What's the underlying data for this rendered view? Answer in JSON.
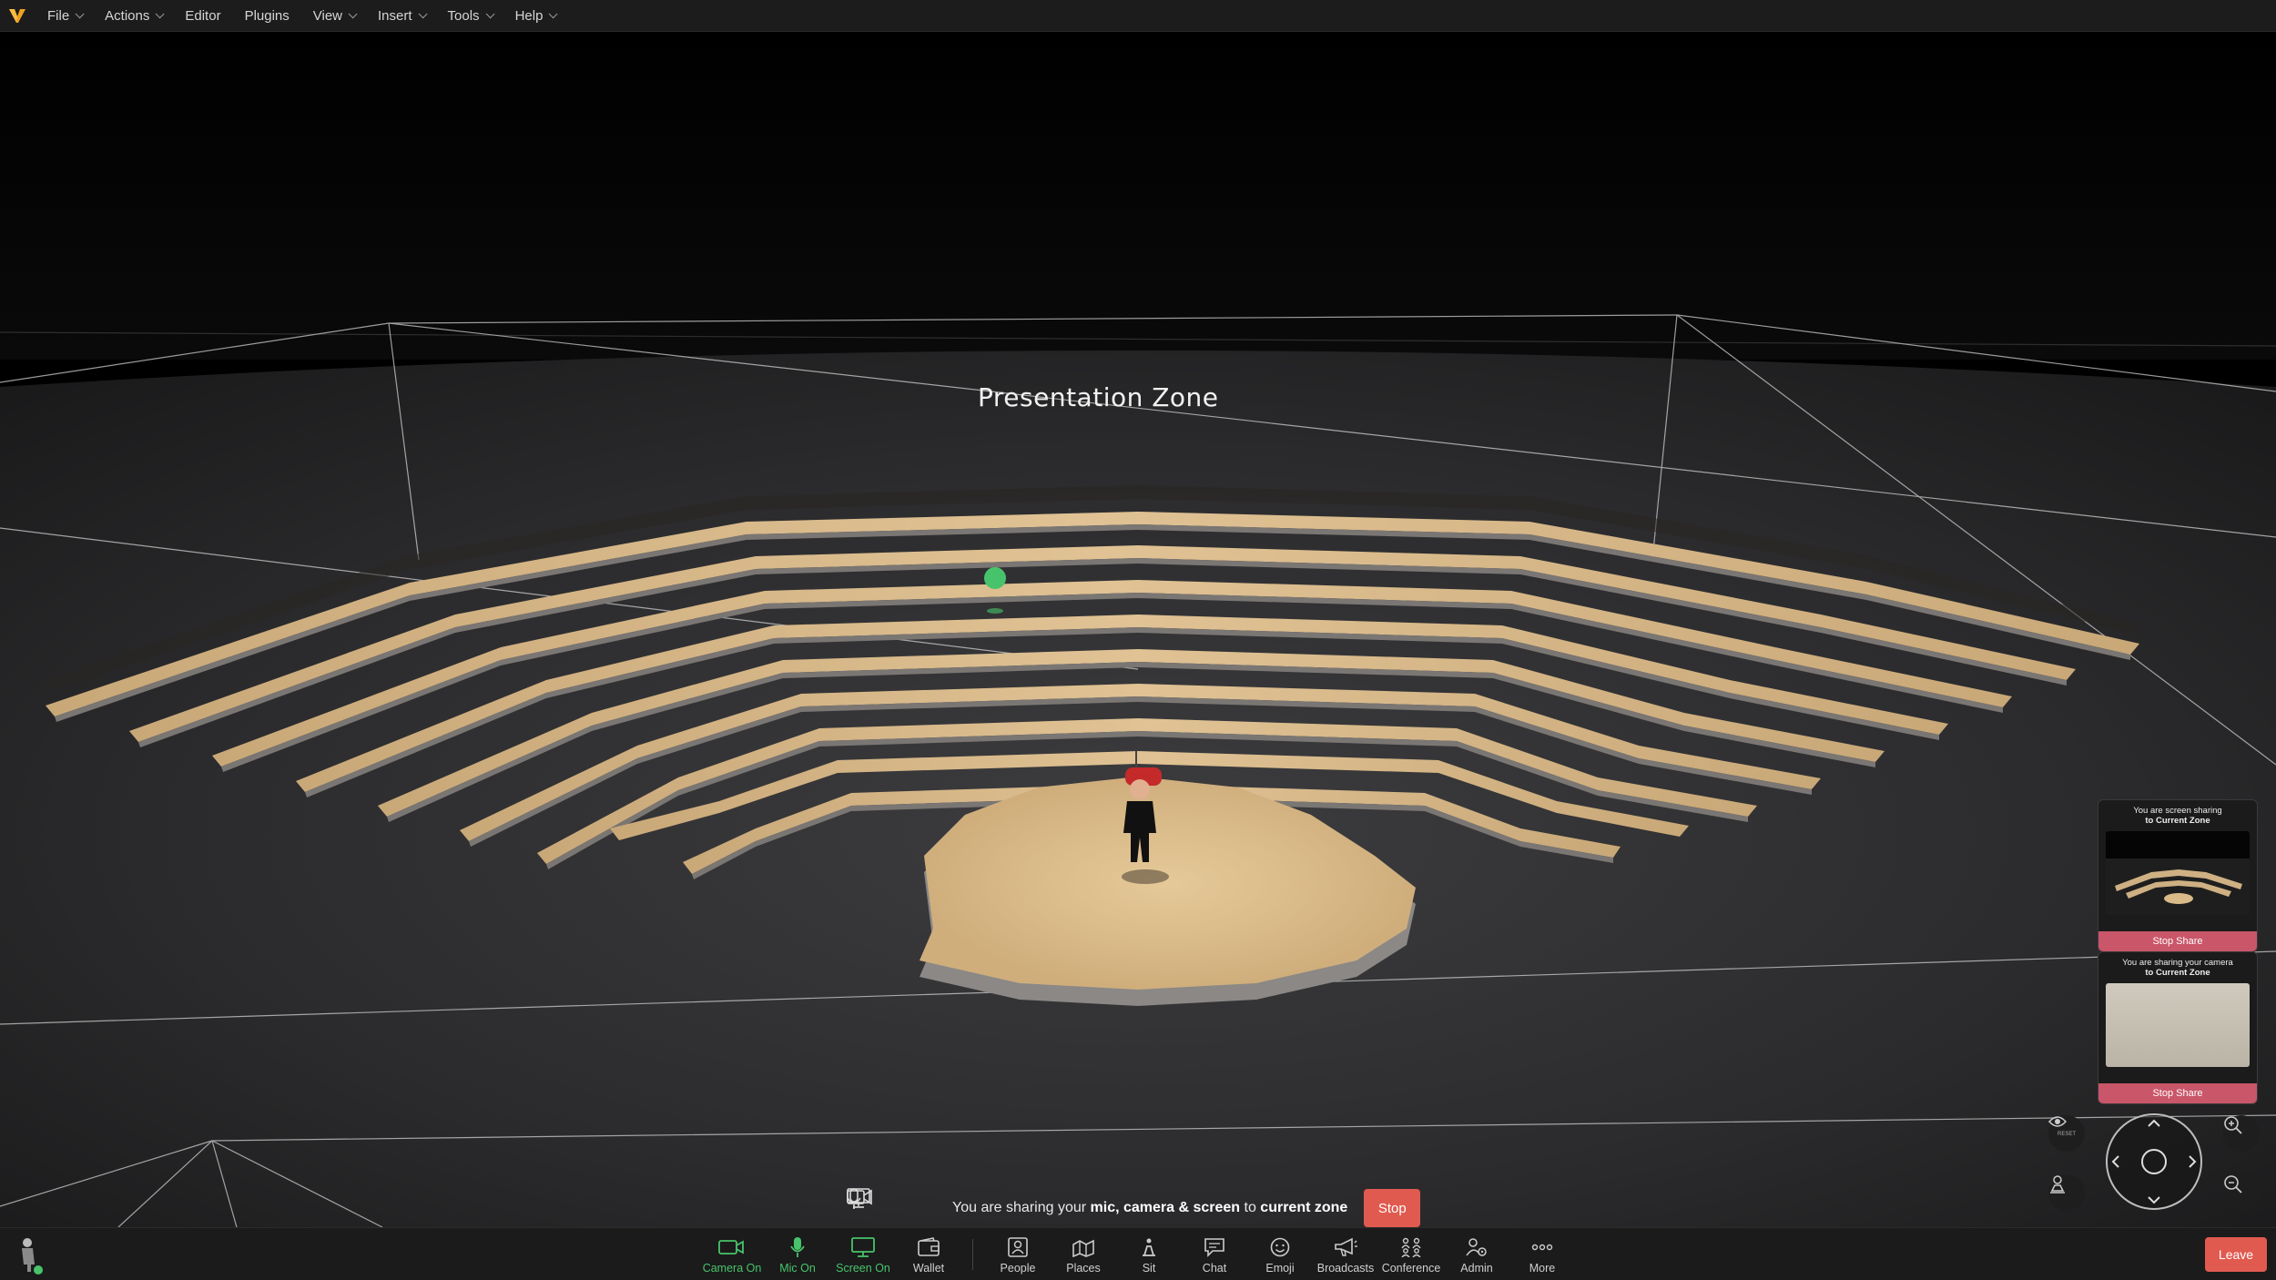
{
  "menubar": {
    "items": [
      {
        "label": "File",
        "has_dropdown": true
      },
      {
        "label": "Actions",
        "has_dropdown": true
      },
      {
        "label": "Editor",
        "has_dropdown": false
      },
      {
        "label": "Plugins",
        "has_dropdown": false
      },
      {
        "label": "View",
        "has_dropdown": true
      },
      {
        "label": "Insert",
        "has_dropdown": true
      },
      {
        "label": "Tools",
        "has_dropdown": true
      },
      {
        "label": "Help",
        "has_dropdown": true
      }
    ]
  },
  "scene": {
    "zone_label": "Presentation Zone"
  },
  "share_cards": [
    {
      "line1": "You are screen sharing",
      "line2": "to Current Zone",
      "button": "Stop Share"
    },
    {
      "line1": "You are sharing your camera",
      "line2": "to Current Zone",
      "button": "Stop Share"
    }
  ],
  "sharing_bar": {
    "prefix": "You are sharing your ",
    "what": "mic, camera & screen",
    "middle": " to ",
    "target": "current zone",
    "stop_label": "Stop"
  },
  "toolbar": {
    "items": [
      {
        "id": "camera",
        "label": "Camera On",
        "active": true,
        "icon": "camera-icon"
      },
      {
        "id": "mic",
        "label": "Mic On",
        "active": true,
        "icon": "microphone-icon"
      },
      {
        "id": "screen",
        "label": "Screen On",
        "active": true,
        "icon": "monitor-icon"
      },
      {
        "id": "wallet",
        "label": "Wallet",
        "active": false,
        "icon": "wallet-icon"
      },
      {
        "id": "people",
        "label": "People",
        "active": false,
        "icon": "people-icon"
      },
      {
        "id": "places",
        "label": "Places",
        "active": false,
        "icon": "places-icon"
      },
      {
        "id": "sit",
        "label": "Sit",
        "active": false,
        "icon": "sit-icon"
      },
      {
        "id": "chat",
        "label": "Chat",
        "active": false,
        "icon": "chat-icon"
      },
      {
        "id": "emoji",
        "label": "Emoji",
        "active": false,
        "icon": "emoji-icon"
      },
      {
        "id": "broadcasts",
        "label": "Broadcasts",
        "active": false,
        "icon": "megaphone-icon"
      },
      {
        "id": "conference",
        "label": "Conference",
        "active": false,
        "icon": "conference-icon"
      },
      {
        "id": "admin",
        "label": "Admin",
        "active": false,
        "icon": "admin-icon"
      },
      {
        "id": "more",
        "label": "More",
        "active": false,
        "icon": "more-icon"
      }
    ],
    "leave_label": "Leave"
  },
  "nav": {
    "reset_label": "RESET"
  },
  "colors": {
    "active_green": "#47c46b",
    "stop_red": "#e05a4f",
    "share_card_button": "#c95669",
    "wood": "#d8b888",
    "menubar_bg": "#1c1c1c"
  }
}
